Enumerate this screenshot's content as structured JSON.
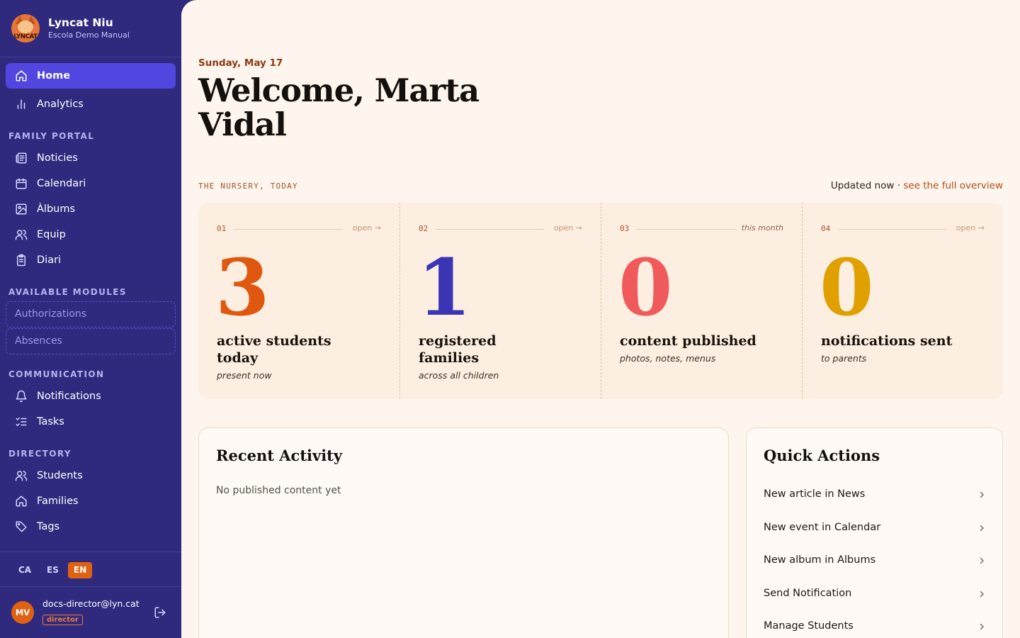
{
  "brand": {
    "name": "Lyncat Niu",
    "subtitle": "Escola Demo Manual",
    "logo_text": "LYNCAT"
  },
  "nav": {
    "top": [
      {
        "label": "Home",
        "icon": "home-icon",
        "active": true
      },
      {
        "label": "Analytics",
        "icon": "bar-chart-icon"
      }
    ],
    "family_portal": {
      "title": "FAMILY PORTAL",
      "items": [
        {
          "label": "Noticies",
          "icon": "newspaper-icon"
        },
        {
          "label": "Calendari",
          "icon": "calendar-icon"
        },
        {
          "label": "Àlbums",
          "icon": "image-icon"
        },
        {
          "label": "Equip",
          "icon": "users-icon"
        },
        {
          "label": "Diari",
          "icon": "clipboard-icon"
        }
      ]
    },
    "available_modules": {
      "title": "AVAILABLE MODULES",
      "items": [
        {
          "label": "Authorizations"
        },
        {
          "label": "Absences"
        }
      ]
    },
    "communication": {
      "title": "COMMUNICATION",
      "items": [
        {
          "label": "Notifications",
          "icon": "bell-icon"
        },
        {
          "label": "Tasks",
          "icon": "list-checks-icon"
        }
      ]
    },
    "directory": {
      "title": "DIRECTORY",
      "items": [
        {
          "label": "Students",
          "icon": "users-icon"
        },
        {
          "label": "Families",
          "icon": "home-icon"
        },
        {
          "label": "Tags",
          "icon": "tag-icon"
        }
      ]
    }
  },
  "languages": [
    {
      "code": "CA",
      "active": false
    },
    {
      "code": "ES",
      "active": false
    },
    {
      "code": "EN",
      "active": true
    }
  ],
  "user": {
    "initials": "MV",
    "email": "docs-director@lyn.cat",
    "role": "director"
  },
  "main": {
    "date": "Sunday, May 17",
    "welcome": "Welcome, Marta Vidal",
    "overview": {
      "kicker": "THE NURSERY, TODAY",
      "updated": "Updated now ·",
      "link": "see the full overview"
    },
    "stats": [
      {
        "index": "01",
        "hint": "open →",
        "value": "3",
        "caption_1": "active students",
        "caption_2": "today",
        "sub": "present now",
        "color": "#e0570f"
      },
      {
        "index": "02",
        "hint": "open →",
        "value": "1",
        "caption_1": "registered",
        "caption_2": "families",
        "sub": "across all children",
        "color": "#3b34b5"
      },
      {
        "index": "03",
        "hint": "this month",
        "value": "0",
        "caption_1": "content published",
        "caption_2": "",
        "sub": "photos, notes, menus",
        "color": "#f05a5a"
      },
      {
        "index": "04",
        "hint": "open →",
        "value": "0",
        "caption_1": "notifications sent",
        "caption_2": "",
        "sub": "to parents",
        "color": "#e0a000"
      }
    ],
    "recent_activity": {
      "title": "Recent Activity",
      "empty": "No published content yet"
    },
    "quick_actions": {
      "title": "Quick Actions",
      "items": [
        "New article in News",
        "New event in Calendar",
        "New album in Albums",
        "Send Notification",
        "Manage Students"
      ]
    }
  }
}
